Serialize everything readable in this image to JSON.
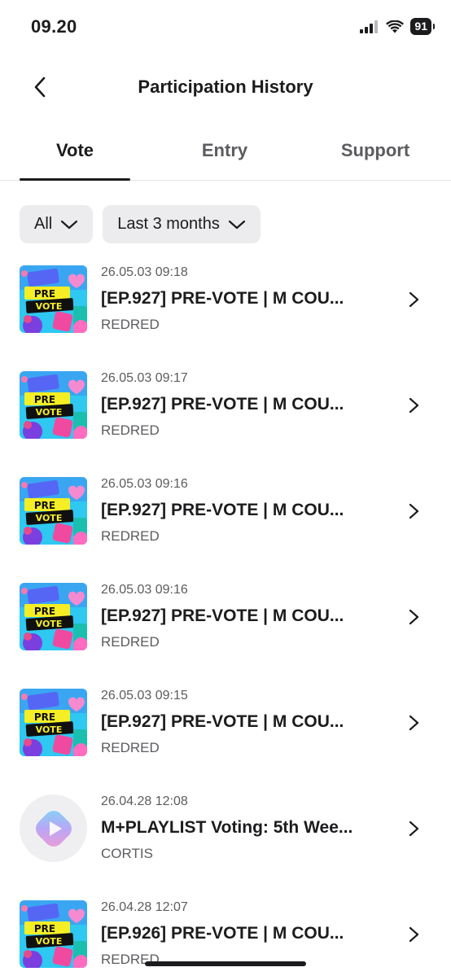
{
  "status": {
    "time": "09.20",
    "battery": "91"
  },
  "nav": {
    "title": "Participation History"
  },
  "tabs": [
    {
      "label": "Vote",
      "active": true
    },
    {
      "label": "Entry",
      "active": false
    },
    {
      "label": "Support",
      "active": false
    }
  ],
  "filters": {
    "type": "All",
    "period": "Last 3 months"
  },
  "thumb_text": {
    "line1": "PRE",
    "line2": "VOTE"
  },
  "items": [
    {
      "date": "26.05.03 09:18",
      "title": "[EP.927] PRE-VOTE | M COU...",
      "artist": "REDRED",
      "thumb": "pre-vote"
    },
    {
      "date": "26.05.03 09:17",
      "title": "[EP.927] PRE-VOTE | M COU...",
      "artist": "REDRED",
      "thumb": "pre-vote"
    },
    {
      "date": "26.05.03 09:16",
      "title": "[EP.927] PRE-VOTE | M COU...",
      "artist": "REDRED",
      "thumb": "pre-vote"
    },
    {
      "date": "26.05.03 09:16",
      "title": "[EP.927] PRE-VOTE | M COU...",
      "artist": "REDRED",
      "thumb": "pre-vote"
    },
    {
      "date": "26.05.03 09:15",
      "title": "[EP.927] PRE-VOTE | M COU...",
      "artist": "REDRED",
      "thumb": "pre-vote"
    },
    {
      "date": "26.04.28 12:08",
      "title": "M+PLAYLIST Voting: 5th Wee...",
      "artist": "CORTIS",
      "thumb": "playlist"
    },
    {
      "date": "26.04.28 12:07",
      "title": "[EP.926] PRE-VOTE | M COU...",
      "artist": "REDRED",
      "thumb": "pre-vote"
    }
  ],
  "icons": {
    "back": "chevron-left-icon",
    "row": "chevron-right-icon",
    "dropdown": "chevron-down-icon",
    "signal": "signal-icon",
    "wifi": "wifi-icon",
    "battery": "battery-icon"
  }
}
